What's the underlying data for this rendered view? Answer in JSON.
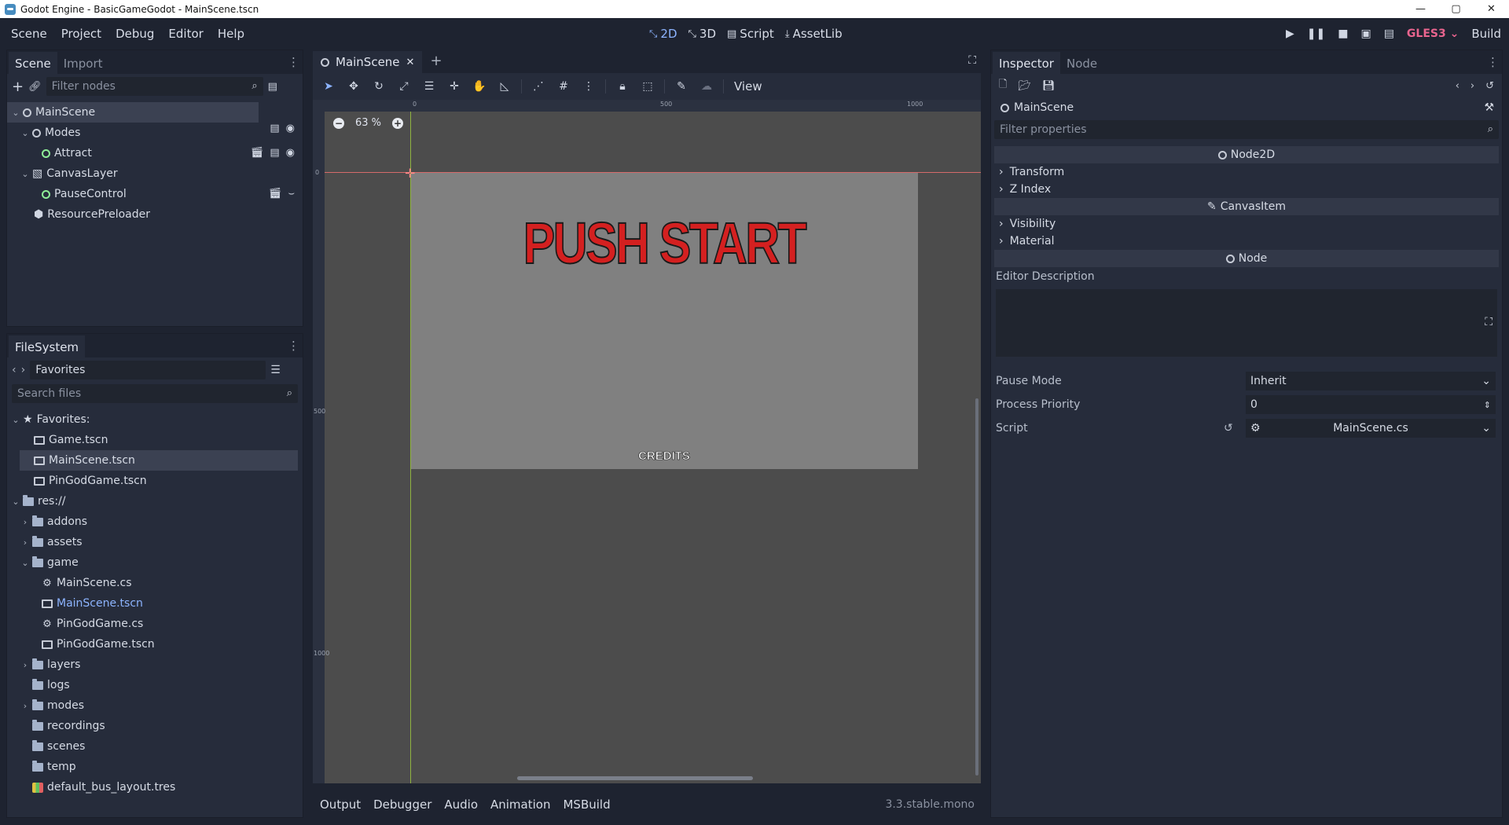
{
  "window": {
    "title": "Godot Engine - BasicGameGodot - MainScene.tscn",
    "controls": [
      "—",
      "▢",
      "✕"
    ]
  },
  "menu": {
    "items": [
      "Scene",
      "Project",
      "Debug",
      "Editor",
      "Help"
    ],
    "workspaces": [
      "2D",
      "3D",
      "Script",
      "AssetLib"
    ],
    "renderer": "GLES3",
    "build": "Build"
  },
  "scene_dock": {
    "tabs": [
      "Scene",
      "Import"
    ],
    "filter_placeholder": "Filter nodes",
    "nodes": [
      {
        "label": "MainScene",
        "depth": 0,
        "icon": "node2d",
        "selected": true
      },
      {
        "label": "Modes",
        "depth": 1,
        "icon": "node2d",
        "selected": false
      },
      {
        "label": "Attract",
        "depth": 2,
        "icon": "node-green",
        "selected": false
      },
      {
        "label": "CanvasLayer",
        "depth": 1,
        "icon": "canvaslayer",
        "selected": false
      },
      {
        "label": "PauseControl",
        "depth": 2,
        "icon": "node-green",
        "selected": false
      },
      {
        "label": "ResourcePreloader",
        "depth": 1,
        "icon": "preloader",
        "selected": false
      }
    ]
  },
  "filesystem": {
    "tab": "FileSystem",
    "path": "Favorites",
    "search_placeholder": "Search files",
    "items": [
      {
        "label": "Favorites:",
        "depth": 0,
        "icon": "star",
        "expanded": true
      },
      {
        "label": "Game.tscn",
        "depth": 1,
        "icon": "scene"
      },
      {
        "label": "MainScene.tscn",
        "depth": 1,
        "icon": "scene",
        "selected": true
      },
      {
        "label": "PinGodGame.tscn",
        "depth": 1,
        "icon": "scene"
      },
      {
        "label": "res://",
        "depth": 0,
        "icon": "folder",
        "expanded": true
      },
      {
        "label": "addons",
        "depth": 1,
        "icon": "folder",
        "collapsed": true
      },
      {
        "label": "assets",
        "depth": 1,
        "icon": "folder",
        "collapsed": true
      },
      {
        "label": "game",
        "depth": 1,
        "icon": "folder",
        "expanded": true
      },
      {
        "label": "MainScene.cs",
        "depth": 2,
        "icon": "gear"
      },
      {
        "label": "MainScene.tscn",
        "depth": 2,
        "icon": "scene",
        "highlight": true
      },
      {
        "label": "PinGodGame.cs",
        "depth": 2,
        "icon": "gear"
      },
      {
        "label": "PinGodGame.tscn",
        "depth": 2,
        "icon": "scene"
      },
      {
        "label": "layers",
        "depth": 1,
        "icon": "folder",
        "collapsed": true
      },
      {
        "label": "logs",
        "depth": 1,
        "icon": "folder"
      },
      {
        "label": "modes",
        "depth": 1,
        "icon": "folder",
        "collapsed": true
      },
      {
        "label": "recordings",
        "depth": 1,
        "icon": "folder"
      },
      {
        "label": "scenes",
        "depth": 1,
        "icon": "folder"
      },
      {
        "label": "temp",
        "depth": 1,
        "icon": "folder"
      },
      {
        "label": "default_bus_layout.tres",
        "depth": 1,
        "icon": "bus"
      }
    ]
  },
  "editor": {
    "scene_tab": "MainScene",
    "view_menu": "View",
    "zoom": "63 %",
    "ruler_labels": {
      "h": [
        "0",
        "500",
        "1000"
      ],
      "v": [
        "0",
        "500",
        "1000"
      ]
    },
    "canvas": {
      "headline": "PUSH START",
      "credits": "CREDITS",
      "headline_color": "#d42020"
    },
    "bottom_tabs": [
      "Output",
      "Debugger",
      "Audio",
      "Animation",
      "MSBuild"
    ],
    "version": "3.3.stable.mono"
  },
  "inspector": {
    "tabs": [
      "Inspector",
      "Node"
    ],
    "object_name": "MainScene",
    "filter_placeholder": "Filter properties",
    "sections": {
      "node2d": "Node2D",
      "canvasitem": "CanvasItem",
      "node": "Node"
    },
    "groups": {
      "transform": "Transform",
      "zindex": "Z Index",
      "visibility": "Visibility",
      "material": "Material"
    },
    "editor_description": "Editor Description",
    "properties": {
      "pause_mode": {
        "label": "Pause Mode",
        "value": "Inherit"
      },
      "process_priority": {
        "label": "Process Priority",
        "value": "0"
      },
      "script": {
        "label": "Script",
        "value": "MainScene.cs"
      }
    }
  },
  "colors": {
    "accent": "#8db4ff",
    "gles": "#e8648e",
    "x_axis": "#d46a6a",
    "y_axis": "#8fb340"
  }
}
